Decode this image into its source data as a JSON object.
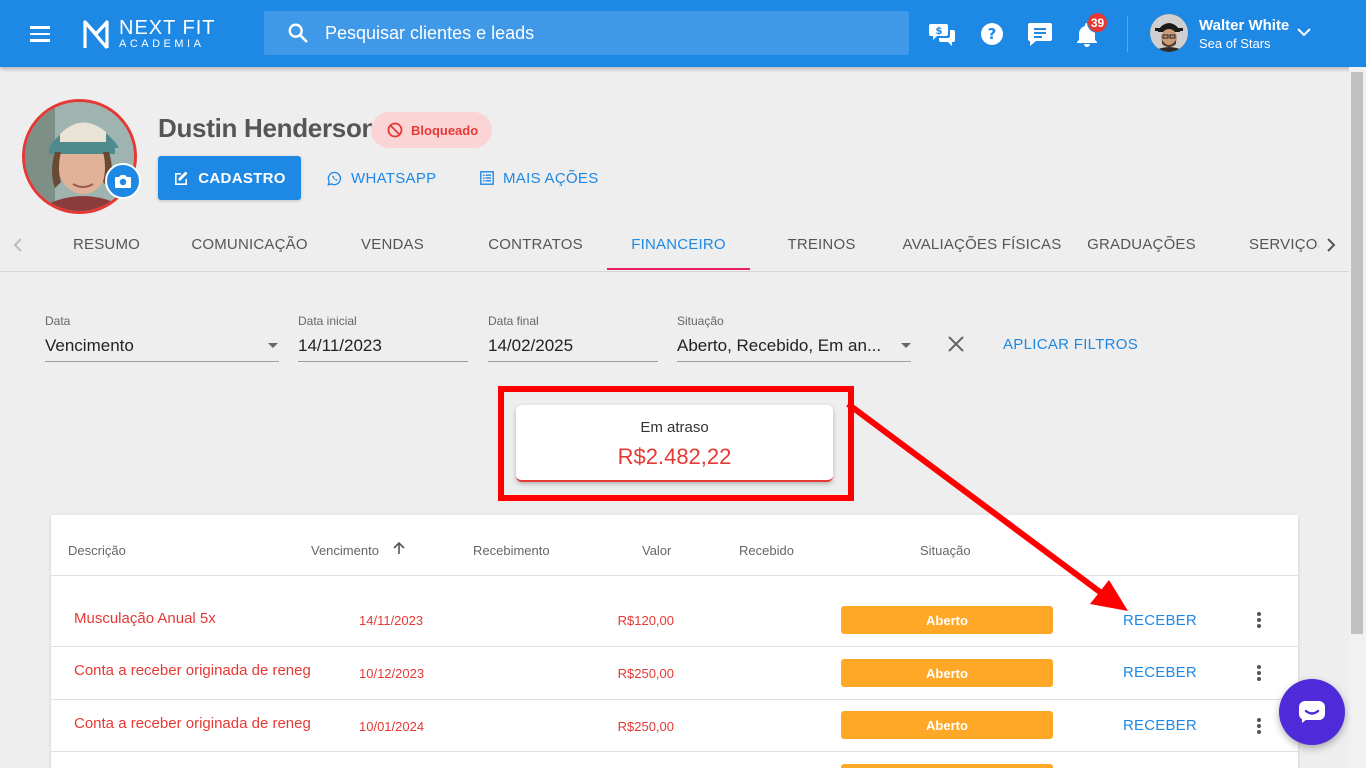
{
  "header": {
    "logo_title": "NEXT FIT",
    "logo_subtitle": "ACADEMIA",
    "search_placeholder": "Pesquisar clientes e leads",
    "notifications_count": "39",
    "user_name": "Walter White",
    "user_org": "Sea of Stars"
  },
  "profile": {
    "name": "Dustin Henderson",
    "status": "Bloqueado",
    "actions": {
      "cadastro": "CADASTRO",
      "whatsapp": "WHATSAPP",
      "more": "MAIS AÇÕES"
    }
  },
  "tabs": [
    {
      "label": "RESUMO"
    },
    {
      "label": "COMUNICAÇÃO"
    },
    {
      "label": "VENDAS"
    },
    {
      "label": "CONTRATOS"
    },
    {
      "label": "FINANCEIRO",
      "active": true
    },
    {
      "label": "TREINOS"
    },
    {
      "label": "AVALIAÇÕES FÍSICAS"
    },
    {
      "label": "GRADUAÇÕES"
    },
    {
      "label": "SERVIÇOS"
    }
  ],
  "filters": {
    "data": {
      "label": "Data",
      "value": "Vencimento"
    },
    "start": {
      "label": "Data inicial",
      "value": "14/11/2023"
    },
    "end": {
      "label": "Data final",
      "value": "14/02/2025"
    },
    "situacao": {
      "label": "Situação",
      "value": "Aberto, Recebido, Em an..."
    },
    "apply": "APLICAR FILTROS"
  },
  "summary": {
    "label": "Em atraso",
    "value": "R$2.482,22"
  },
  "table": {
    "headers": {
      "descricao": "Descrição",
      "vencimento": "Vencimento",
      "recebimento": "Recebimento",
      "valor": "Valor",
      "recebido": "Recebido",
      "situacao": "Situação"
    },
    "rows": [
      {
        "descricao": "Musculação Anual 5x",
        "vencimento": "14/11/2023",
        "valor": "R$120,00",
        "situacao": "Aberto",
        "action": "RECEBER"
      },
      {
        "descricao": "Conta a receber originada de renegociação",
        "vencimento": "10/12/2023",
        "valor": "R$250,00",
        "situacao": "Aberto",
        "action": "RECEBER"
      },
      {
        "descricao": "Conta a receber originada de renegociação",
        "vencimento": "10/01/2024",
        "valor": "R$250,00",
        "situacao": "Aberto",
        "action": "RECEBER"
      }
    ]
  },
  "colors": {
    "primary": "#1e88e5",
    "danger": "#e53935",
    "warning": "#ffa726",
    "annotation": "#ff0000",
    "chat": "#4f2ad8"
  }
}
